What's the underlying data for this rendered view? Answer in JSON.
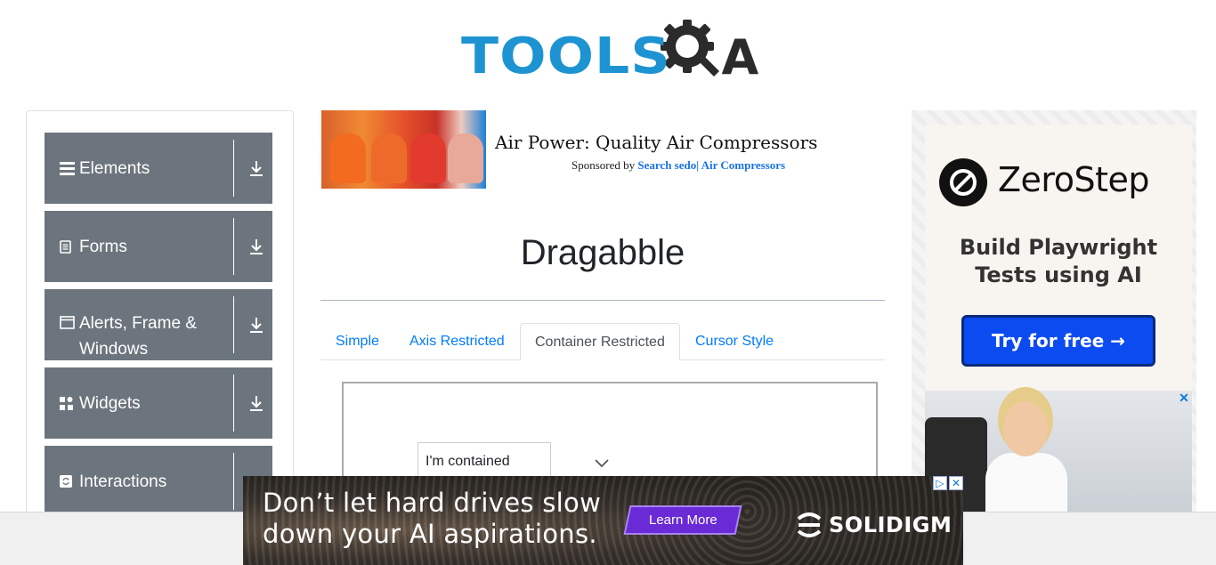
{
  "header": {
    "logo_text": "TOOLS",
    "logo_suffix": "A"
  },
  "sidebar": {
    "groups": [
      {
        "label": "Elements",
        "icon": "hamburger-icon"
      },
      {
        "label": "Forms",
        "icon": "document-icon"
      },
      {
        "label": "Alerts, Frame & Windows",
        "icon": "window-icon"
      },
      {
        "label": "Widgets",
        "icon": "grid-icon"
      },
      {
        "label": "Interactions",
        "icon": "refresh-icon"
      }
    ]
  },
  "ad_top": {
    "title": "Air Power: Quality Air Compressors",
    "sponsored_by": "Sponsored by",
    "sponsor_link": "Search sedo| Air Compressors"
  },
  "main": {
    "title": "Dragabble",
    "tabs": [
      {
        "label": "Simple",
        "active": false
      },
      {
        "label": "Axis Restricted",
        "active": false
      },
      {
        "label": "Container Restricted",
        "active": true
      },
      {
        "label": "Cursor Style",
        "active": false
      }
    ],
    "drag_box_text": "I'm contained"
  },
  "ad_right": {
    "brand": "ZeroStep",
    "line1": "Build Playwright",
    "line2": "Tests using AI",
    "cta": "Try for free →",
    "close": "✕"
  },
  "ad_bottom": {
    "line1": "Don’t let hard drives slow",
    "line2": "down your AI aspirations.",
    "cta": "Learn More",
    "brand": "SOLIDIGM",
    "choices_info": "▷",
    "choices_close": "✕"
  },
  "colors": {
    "sidebar_group_bg": "#6c757d",
    "tab_link": "#007bff",
    "logo_blue": "#1d93d1",
    "ad_cta_blue": "#0b4bf0"
  }
}
